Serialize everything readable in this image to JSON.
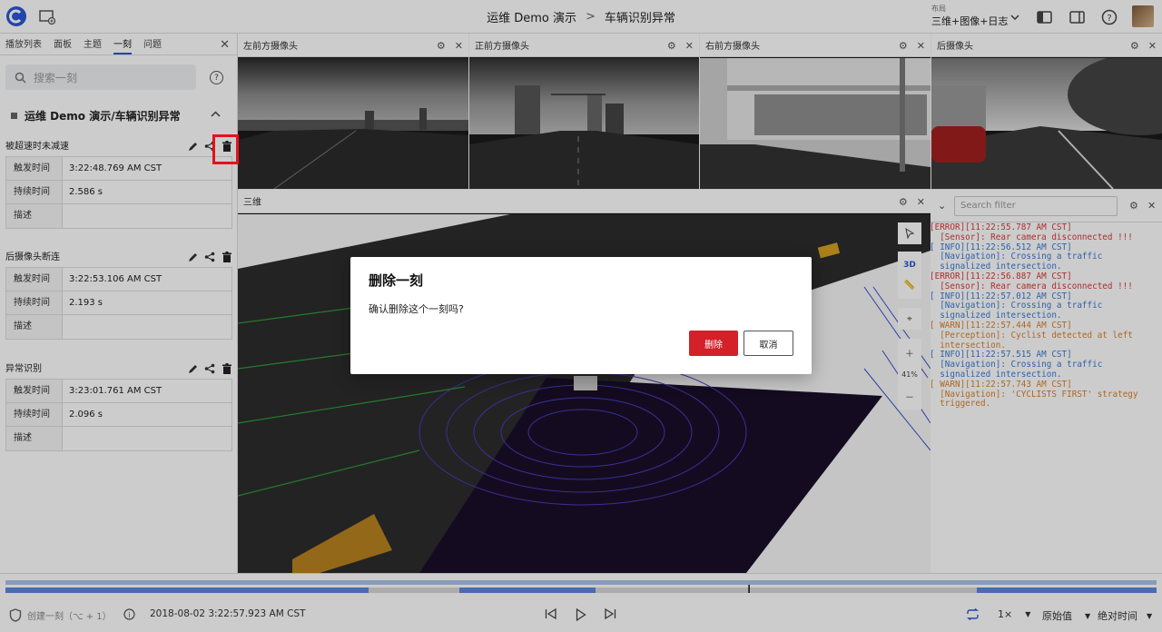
{
  "header": {
    "breadcrumb_parent": "运维 Demo 演示",
    "breadcrumb_sep": ">",
    "breadcrumb_current": "车辆识别异常",
    "layout_label": "布局",
    "layout_value": "三维+图像+日志"
  },
  "left_panel": {
    "tabs": [
      {
        "label": "播放列表"
      },
      {
        "label": "面板"
      },
      {
        "label": "主题"
      },
      {
        "label": "一刻"
      },
      {
        "label": "问题"
      }
    ],
    "search_placeholder": "搜索一刻",
    "group_title": "运维 Demo 演示/车辆识别异常",
    "moments": [
      {
        "name": "被超速时未减速",
        "trigger_label": "触发时间",
        "trigger": "3:22:48.769 AM CST",
        "duration_label": "持续时间",
        "duration": "2.586 s",
        "desc_label": "描述",
        "desc": ""
      },
      {
        "name": "后摄像头断连",
        "trigger_label": "触发时间",
        "trigger": "3:22:53.106 AM CST",
        "duration_label": "持续时间",
        "duration": "2.193 s",
        "desc_label": "描述",
        "desc": ""
      },
      {
        "name": "异常识别",
        "trigger_label": "触发时间",
        "trigger": "3:23:01.761 AM CST",
        "duration_label": "持续时间",
        "duration": "2.096 s",
        "desc_label": "描述",
        "desc": ""
      }
    ]
  },
  "panels": {
    "cam_front_left": "左前方摄像头",
    "cam_front": "正前方摄像头",
    "cam_front_right": "右前方摄像头",
    "cam_rear": "后摄像头",
    "three_d": "三维",
    "log_filter_placeholder": "Search filter",
    "zoom": "41%",
    "mode_3d": "3D"
  },
  "logs": [
    {
      "level": "e",
      "head": "[ERROR][11:22:55.787 AM CST]",
      "body": "  [Sensor]: Rear camera disconnected !!!"
    },
    {
      "level": "i",
      "head": "[ INFO][11:22:56.512 AM CST]",
      "body": "  [Navigation]: Crossing a traffic",
      "body2": "  signalized intersection."
    },
    {
      "level": "e",
      "head": "[ERROR][11:22:56.887 AM CST]",
      "body": "  [Sensor]: Rear camera disconnected !!!"
    },
    {
      "level": "i",
      "head": "[ INFO][11:22:57.012 AM CST]",
      "body": "  [Navigation]: Crossing a traffic",
      "body2": "  signalized intersection."
    },
    {
      "level": "w",
      "head": "[ WARN][11:22:57.444 AM CST]",
      "body": "  [Perception]: Cyclist detected at left",
      "body2": "  intersection."
    },
    {
      "level": "i",
      "head": "[ INFO][11:22:57.515 AM CST]",
      "body": "  [Navigation]: Crossing a traffic",
      "body2": "  signalized intersection."
    },
    {
      "level": "w",
      "head": "[ WARN][11:22:57.743 AM CST]",
      "body": "  [Navigation]: 'CYCLISTS FIRST' strategy",
      "body2": "  triggered."
    }
  ],
  "bottom": {
    "create_moment": "创建一刻（⌥ + 1）",
    "timestamp": "2018-08-02 3:22:57.923 AM CST",
    "speed": "1×",
    "value_mode": "原始值",
    "time_mode": "绝对时间",
    "playback_progress": 0.646
  },
  "dialog": {
    "title": "删除一刻",
    "message": "确认删除这个一刻吗?",
    "confirm": "删除",
    "cancel": "取消"
  }
}
